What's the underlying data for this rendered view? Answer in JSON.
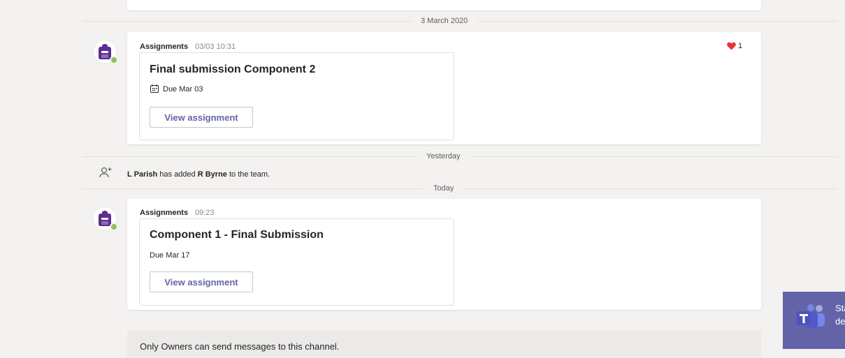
{
  "dates": {
    "first": "3 March 2020",
    "second": "Yesterday",
    "third": "Today"
  },
  "messages": [
    {
      "sender": "Assignments",
      "time": "03/03 10:31",
      "assignment_title": "Final submission Component 2",
      "due": "Due Mar 03",
      "button": "View assignment",
      "reaction_count": "1"
    },
    {
      "sender": "Assignments",
      "time": "09:23",
      "assignment_title": "Component 1 - Final Submission",
      "due": "Due Mar 17",
      "button": "View assignment"
    }
  ],
  "system_message": {
    "actor": "L Parish",
    "action": " has added ",
    "target": "R Byrne",
    "suffix": " to the team."
  },
  "compose": {
    "notice": "Only Owners can send messages to this channel."
  },
  "toast": {
    "text": "Sta\nde"
  },
  "colors": {
    "brand": "#6264a7",
    "avatar": "#5c2e91",
    "presence": "#92c353",
    "reaction_heart": "#e83338"
  },
  "icons": {
    "avatar": "backpack-icon",
    "presence": "available-status-icon",
    "reaction": "heart-icon",
    "due": "calendar-icon",
    "system": "person-add-icon",
    "toast": "teams-logo-icon"
  }
}
